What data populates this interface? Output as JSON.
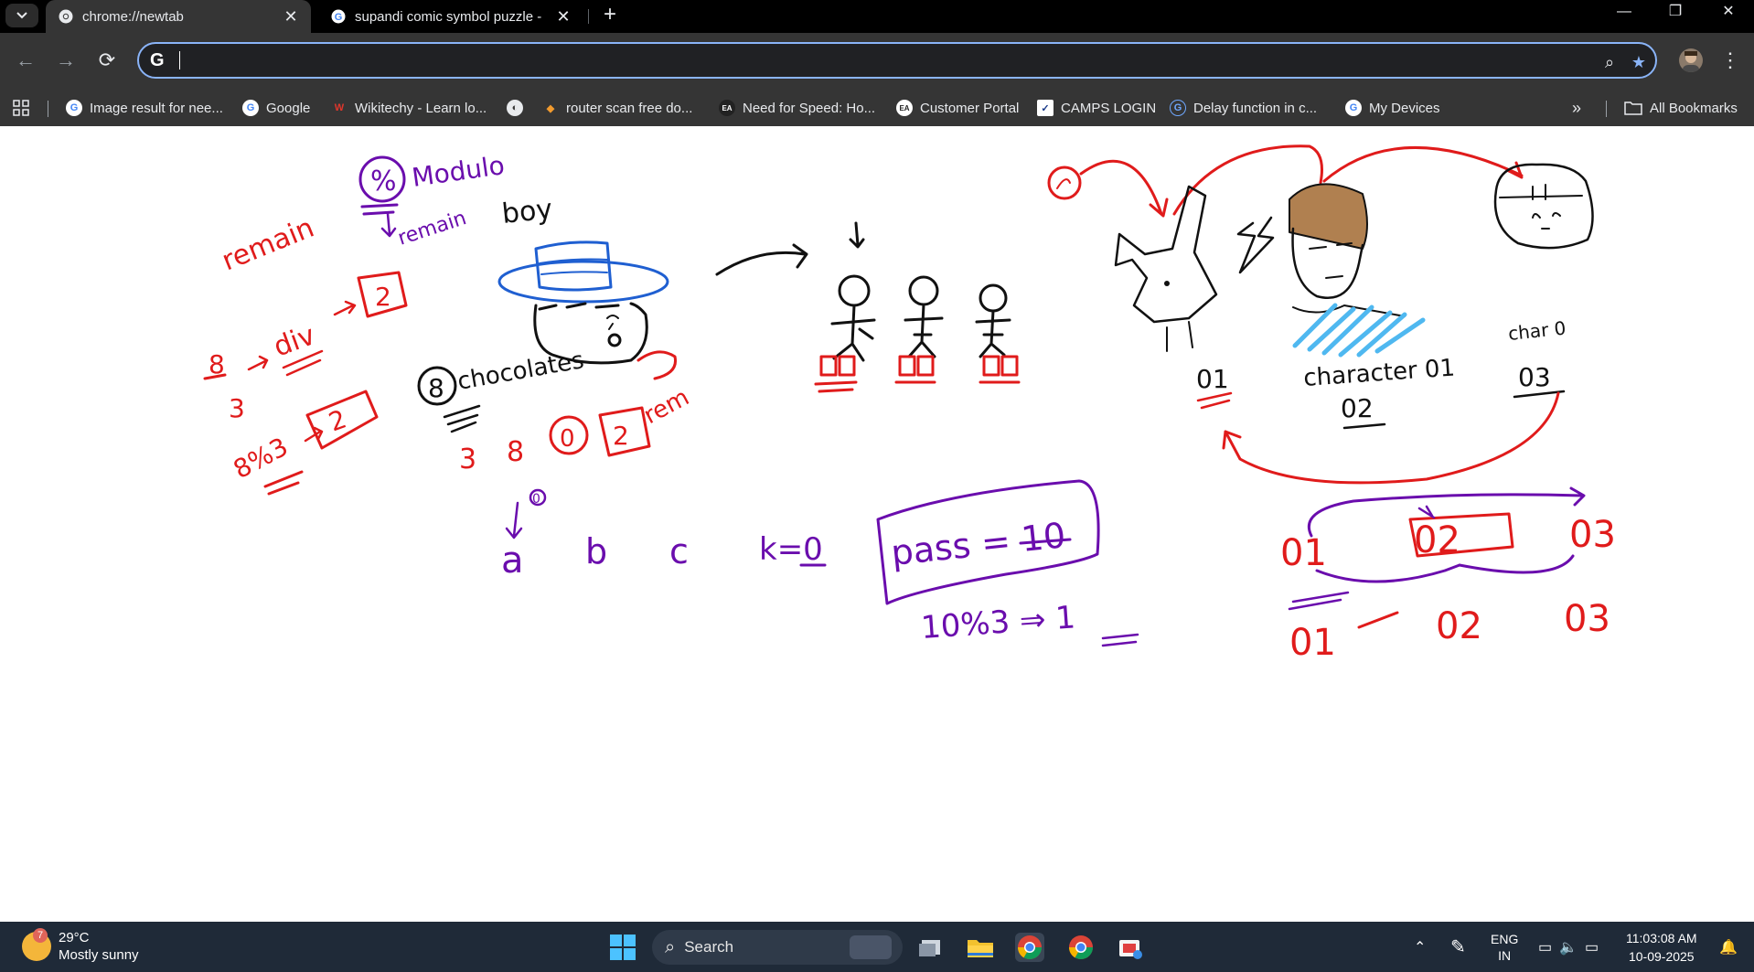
{
  "browser": {
    "tabs": [
      {
        "title": "chrome://newtab",
        "active": true,
        "favicon": "chrome-icon"
      },
      {
        "title": "supandi comic symbol puzzle -",
        "active": false,
        "favicon": "google-icon"
      }
    ],
    "omnibox": {
      "value": "",
      "placeholder": ""
    },
    "bookmarks": [
      {
        "label": "Image result for nee...",
        "icon": "google-icon"
      },
      {
        "label": "Google",
        "icon": "google-icon"
      },
      {
        "label": "Wikitechy - Learn lo...",
        "icon": "wikitechy-icon"
      },
      {
        "label": "",
        "icon": "globe-icon"
      },
      {
        "label": "router scan free do...",
        "icon": "router-icon"
      },
      {
        "label": "Need for Speed: Ho...",
        "icon": "ea-icon"
      },
      {
        "label": "Customer Portal",
        "icon": "ea-icon"
      },
      {
        "label": "CAMPS LOGIN",
        "icon": "camps-icon"
      },
      {
        "label": "Delay function in c...",
        "icon": "delay-icon"
      },
      {
        "label": "My Devices",
        "icon": "google-icon"
      }
    ],
    "overflow_label": "»",
    "all_bookmarks_label": "All Bookmarks"
  },
  "whiteboard": {
    "modulo_symbol": "%",
    "modulo_label": "Modulo",
    "remain_label": "remain",
    "remainder_label": "remain",
    "boy_label": "boy",
    "div_label": "div",
    "div_result": "2",
    "expr_8": "8",
    "expr_3": "3",
    "modulo_expr": "8%3",
    "modulo_result": "2",
    "chocolates_count": "8",
    "chocolates_label": "chocolates",
    "row_3": "3",
    "row_8": "8",
    "row_2": "2",
    "row_rem": "rem",
    "marker_zero": "0",
    "var_a": "a",
    "var_b": "b",
    "var_c": "c",
    "k_assign": "k=0",
    "pass_assign": "pass = 10",
    "pass_expr": "10%3 ⇒ 1",
    "char_label_01": "01",
    "char_label_middle": "character 01",
    "char_label_02": "02",
    "char_label_char": "char 0",
    "char_label_03": "03",
    "seq_top": [
      "01",
      "02",
      "03"
    ],
    "seq_bottom": [
      "01",
      "02",
      "03"
    ],
    "circled_zero": "0"
  },
  "taskbar": {
    "weather_temp": "29°C",
    "weather_desc": "Mostly sunny",
    "weather_badge": "7",
    "search_label": "Search",
    "lang_line1": "ENG",
    "lang_line2": "IN",
    "time": "11:03:08 AM",
    "date": "10-09-2025"
  },
  "colors": {
    "red_ink": "#e01b1b",
    "purple_ink": "#6a0dad",
    "blue_ink": "#1f5fd1",
    "black_ink": "#111111",
    "hair_brown": "#b08050",
    "shirt_blue": "#4fb8f0",
    "accent": "#8ab4f8"
  }
}
